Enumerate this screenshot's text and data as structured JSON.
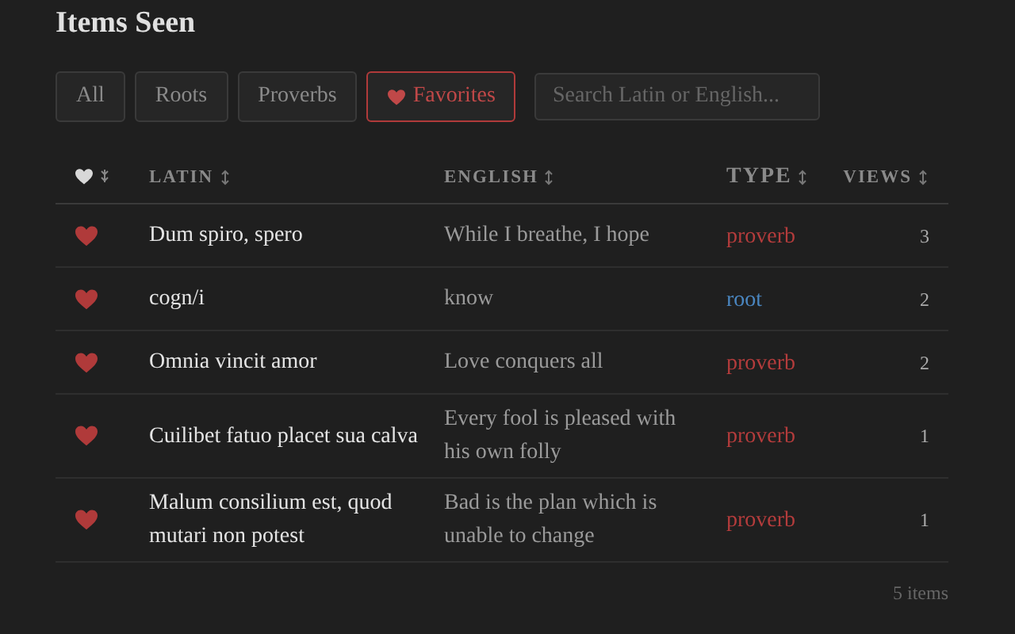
{
  "title": "Items Seen",
  "filters": [
    {
      "label": "All",
      "selected": false,
      "kind": "plain"
    },
    {
      "label": "Roots",
      "selected": false,
      "kind": "plain"
    },
    {
      "label": "Proverbs",
      "selected": false,
      "kind": "plain"
    },
    {
      "label": "Favorites",
      "selected": true,
      "kind": "favorite"
    }
  ],
  "search": {
    "placeholder": "Search Latin or English..."
  },
  "columns": [
    "LATIN",
    "ENGLISH",
    "TYPE",
    "VIEWS"
  ],
  "rows": [
    {
      "favorite": true,
      "latin": "Dum spiro, spero",
      "english": "While I breathe, I hope",
      "type": {
        "label": "proverb",
        "kind": "proverb"
      },
      "views": "3"
    },
    {
      "favorite": true,
      "latin": "cogn/i",
      "english": "know",
      "type": {
        "label": "root",
        "kind": "root"
      },
      "views": "2"
    },
    {
      "favorite": true,
      "latin": "Omnia vincit amor",
      "english": "Love conquers all",
      "type": {
        "label": "proverb",
        "kind": "proverb"
      },
      "views": "2"
    },
    {
      "favorite": true,
      "latin": "Cuilibet fatuo placet sua calva",
      "english": "Every fool is pleased with his own folly",
      "type": {
        "label": "proverb",
        "kind": "proverb"
      },
      "views": "1"
    },
    {
      "favorite": true,
      "latin": "Malum consilium est, quod mutari non potest",
      "english": "Bad is the plan which is unable to change",
      "type": {
        "label": "proverb",
        "kind": "proverb"
      },
      "views": "1"
    }
  ],
  "footer": "5 items"
}
